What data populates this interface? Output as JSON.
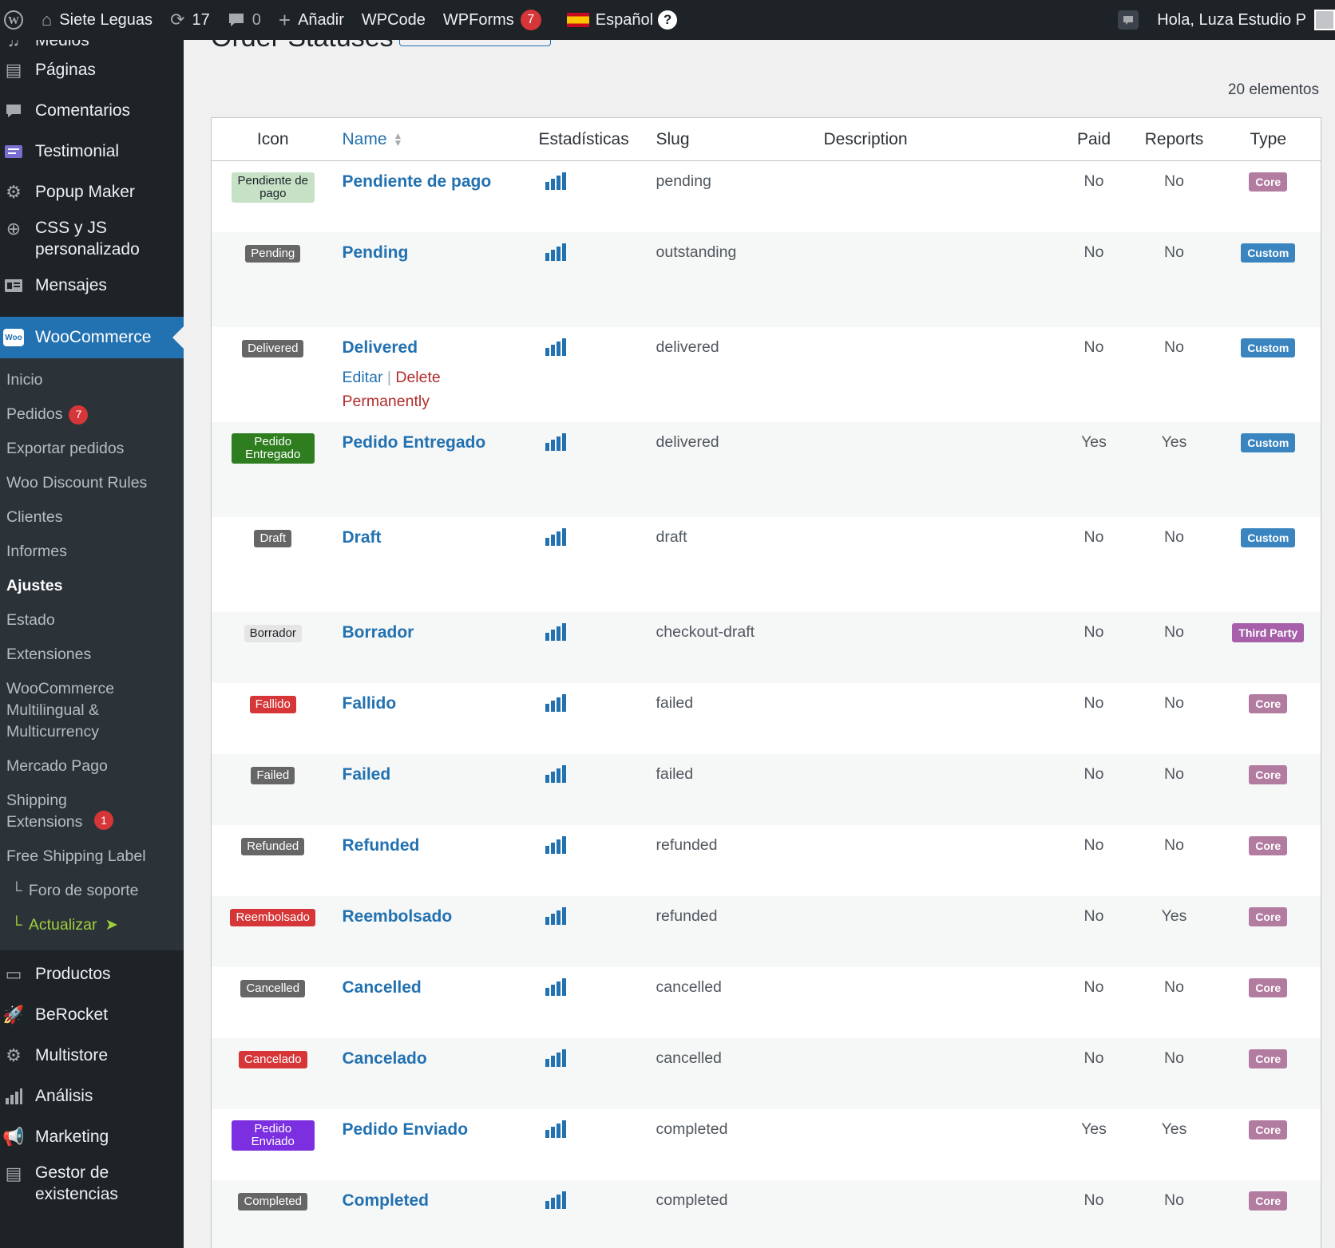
{
  "admin_bar": {
    "site_name": "Siete Leguas",
    "updates_count": "17",
    "comments_count": "0",
    "add_new": "Añadir",
    "wpcode": "WPCode",
    "wpforms": "WPForms",
    "wpforms_count": "7",
    "language": "Español",
    "help": "?",
    "greeting": "Hola, Luza Estudio P"
  },
  "sidebar": {
    "top_items": [
      {
        "label": "Medios",
        "icon": "media-icon"
      },
      {
        "label": "Páginas",
        "icon": "pages-icon"
      },
      {
        "label": "Comentarios",
        "icon": "comments-icon"
      },
      {
        "label": "Testimonial",
        "icon": "testimonial-icon"
      },
      {
        "label": "Popup Maker",
        "icon": "popup-icon"
      },
      {
        "label": "CSS y JS personalizado",
        "icon": "plus-circle-icon"
      },
      {
        "label": "Mensajes",
        "icon": "messages-icon"
      }
    ],
    "woocommerce": {
      "label": "WooCommerce",
      "icon_text": "Woo"
    },
    "submenu": [
      {
        "label": "Inicio"
      },
      {
        "label": "Pedidos",
        "badge": "7"
      },
      {
        "label": "Exportar pedidos"
      },
      {
        "label": "Woo Discount Rules"
      },
      {
        "label": "Clientes"
      },
      {
        "label": "Informes"
      },
      {
        "label": "Ajustes"
      },
      {
        "label": "Estado"
      },
      {
        "label": "Extensiones"
      },
      {
        "label": "WooCommerce Multilingual & Multicurrency"
      },
      {
        "label": "Mercado Pago"
      },
      {
        "label": "Shipping Extensions",
        "badge": "1"
      },
      {
        "label": "Free Shipping Label"
      },
      {
        "label": "Foro de soporte"
      },
      {
        "label": "Actualizar"
      }
    ],
    "bottom_items": [
      {
        "label": "Productos",
        "icon": "archive-icon"
      },
      {
        "label": "BeRocket",
        "icon": "rocket-icon"
      },
      {
        "label": "Multistore",
        "icon": "gear-icon"
      },
      {
        "label": "Análisis",
        "icon": "bar-chart-icon"
      },
      {
        "label": "Marketing",
        "icon": "megaphone-icon"
      },
      {
        "label": "Gestor de existencias",
        "icon": "book-icon"
      }
    ]
  },
  "page": {
    "title": "Order Statuses",
    "items_count": "20 elementos"
  },
  "table": {
    "headers": {
      "icon": "Icon",
      "name": "Name",
      "stats": "Estadísticas",
      "slug": "Slug",
      "description": "Description",
      "paid": "Paid",
      "reports": "Reports",
      "type": "Type"
    },
    "row_actions": {
      "edit": "Editar",
      "sep": "|",
      "delete": "Delete Permanently"
    },
    "type_colors": {
      "Core": "#b27ba0",
      "Custom": "#3a85c0",
      "Third Party": "#a65fa8"
    },
    "rows": [
      {
        "icon_label": "Pendiente de pago",
        "icon_bg": "#c6e1c6",
        "icon_fg": "#1d2327",
        "name": "Pendiente de pago",
        "slug": "pending",
        "description": "",
        "paid": "No",
        "reports": "No",
        "type": "Core"
      },
      {
        "icon_label": "Pending",
        "icon_bg": "#666666",
        "icon_fg": "#ffffff",
        "name": "Pending",
        "slug": "outstanding",
        "description": "",
        "paid": "No",
        "reports": "No",
        "type": "Custom"
      },
      {
        "icon_label": "Delivered",
        "icon_bg": "#666666",
        "icon_fg": "#ffffff",
        "name": "Delivered",
        "slug": "delivered",
        "description": "",
        "paid": "No",
        "reports": "No",
        "type": "Custom"
      },
      {
        "icon_label": "Pedido Entregado",
        "icon_bg": "#2e7d1f",
        "icon_fg": "#ffffff",
        "name": "Pedido Entregado",
        "slug": "delivered",
        "description": "",
        "paid": "Yes",
        "reports": "Yes",
        "type": "Custom"
      },
      {
        "icon_label": "Draft",
        "icon_bg": "#666666",
        "icon_fg": "#ffffff",
        "name": "Draft",
        "slug": "draft",
        "description": "",
        "paid": "No",
        "reports": "No",
        "type": "Custom"
      },
      {
        "icon_label": "Borrador",
        "icon_bg": "#e5e5e5",
        "icon_fg": "#1d2327",
        "name": "Borrador",
        "slug": "checkout-draft",
        "description": "",
        "paid": "No",
        "reports": "No",
        "type": "Third Party"
      },
      {
        "icon_label": "Fallido",
        "icon_bg": "#d63638",
        "icon_fg": "#ffffff",
        "name": "Fallido",
        "slug": "failed",
        "description": "",
        "paid": "No",
        "reports": "No",
        "type": "Core"
      },
      {
        "icon_label": "Failed",
        "icon_bg": "#666666",
        "icon_fg": "#ffffff",
        "name": "Failed",
        "slug": "failed",
        "description": "",
        "paid": "No",
        "reports": "No",
        "type": "Core"
      },
      {
        "icon_label": "Refunded",
        "icon_bg": "#666666",
        "icon_fg": "#ffffff",
        "name": "Refunded",
        "slug": "refunded",
        "description": "",
        "paid": "No",
        "reports": "No",
        "type": "Core"
      },
      {
        "icon_label": "Reembolsado",
        "icon_bg": "#d63638",
        "icon_fg": "#ffffff",
        "name": "Reembolsado",
        "slug": "refunded",
        "description": "",
        "paid": "No",
        "reports": "Yes",
        "type": "Core"
      },
      {
        "icon_label": "Cancelled",
        "icon_bg": "#666666",
        "icon_fg": "#ffffff",
        "name": "Cancelled",
        "slug": "cancelled",
        "description": "",
        "paid": "No",
        "reports": "No",
        "type": "Core"
      },
      {
        "icon_label": "Cancelado",
        "icon_bg": "#d63638",
        "icon_fg": "#ffffff",
        "name": "Cancelado",
        "slug": "cancelled",
        "description": "",
        "paid": "No",
        "reports": "No",
        "type": "Core"
      },
      {
        "icon_label": "Pedido Enviado",
        "icon_bg": "#7b2fe0",
        "icon_fg": "#ffffff",
        "name": "Pedido Enviado",
        "slug": "completed",
        "description": "",
        "paid": "Yes",
        "reports": "Yes",
        "type": "Core"
      },
      {
        "icon_label": "Completed",
        "icon_bg": "#666666",
        "icon_fg": "#ffffff",
        "name": "Completed",
        "slug": "completed",
        "description": "",
        "paid": "No",
        "reports": "No",
        "type": "Core"
      }
    ]
  }
}
